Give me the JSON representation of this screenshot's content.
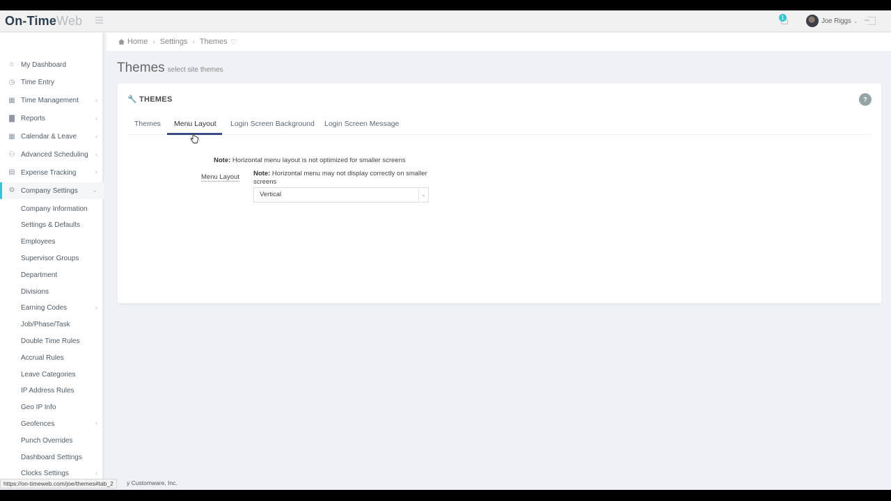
{
  "header": {
    "logo_bold": "On-Time",
    "logo_light": "Web",
    "notification_count": "1",
    "user_name": "Joe Riggs"
  },
  "sidebar": {
    "items": [
      {
        "label": "My Dashboard",
        "icon": "home-icon",
        "has_arrow": false
      },
      {
        "label": "Time Entry",
        "icon": "clock-icon",
        "has_arrow": false
      },
      {
        "label": "Time Management",
        "icon": "calendar-icon",
        "has_arrow": true
      },
      {
        "label": "Reports",
        "icon": "bar-chart-icon",
        "has_arrow": true
      },
      {
        "label": "Calendar & Leave",
        "icon": "calendar-icon",
        "has_arrow": true
      },
      {
        "label": "Advanced Scheduling",
        "icon": "users-icon",
        "has_arrow": true
      },
      {
        "label": "Expense Tracking",
        "icon": "money-icon",
        "has_arrow": true
      },
      {
        "label": "Company Settings",
        "icon": "gears-icon",
        "has_arrow": true,
        "active": true
      }
    ],
    "sub_items": [
      {
        "label": "Company Information",
        "has_arrow": false
      },
      {
        "label": "Settings & Defaults",
        "has_arrow": false
      },
      {
        "label": "Employees",
        "has_arrow": false
      },
      {
        "label": "Supervisor Groups",
        "has_arrow": false
      },
      {
        "label": "Department",
        "has_arrow": false
      },
      {
        "label": "Divisions",
        "has_arrow": false
      },
      {
        "label": "Earning Codes",
        "has_arrow": true
      },
      {
        "label": "Job/Phase/Task",
        "has_arrow": false
      },
      {
        "label": "Double Time Rules",
        "has_arrow": false
      },
      {
        "label": "Accrual Rules",
        "has_arrow": false
      },
      {
        "label": "Leave Categories",
        "has_arrow": false
      },
      {
        "label": "IP Address Rules",
        "has_arrow": false
      },
      {
        "label": "Geo IP Info",
        "has_arrow": false
      },
      {
        "label": "Geofences",
        "has_arrow": true
      },
      {
        "label": "Punch Overrides",
        "has_arrow": false
      },
      {
        "label": "Dashboard Settings",
        "has_arrow": false
      },
      {
        "label": "Clocks Settings",
        "has_arrow": true
      }
    ]
  },
  "breadcrumb": [
    "Home",
    "Settings",
    "Themes"
  ],
  "page": {
    "title": "Themes",
    "subtitle": "select site themes"
  },
  "portlet": {
    "title": "THEMES",
    "help": "?",
    "tabs": [
      "Themes",
      "Menu Layout",
      "Login Screen Background",
      "Login Screen Message"
    ],
    "active_tab": "Menu Layout",
    "note_top_bold": "Note:",
    "note_top_text": " Horizontal menu layout is not optimized for smaller screens",
    "field_label": "Menu Layout",
    "note_right_bold": "Note:",
    "note_right_text": " Horizontal menu may not display correctly on smaller screens",
    "select_value": "Vertical"
  },
  "footer": {
    "status_url": "https://on-timeweb.com/joe/themes#tab_2",
    "copyright": "y Customware, Inc."
  },
  "colors": {
    "accent": "#36c6d3",
    "tab_underline": "#3a4a8a",
    "brand_dark": "#2c3e50"
  }
}
